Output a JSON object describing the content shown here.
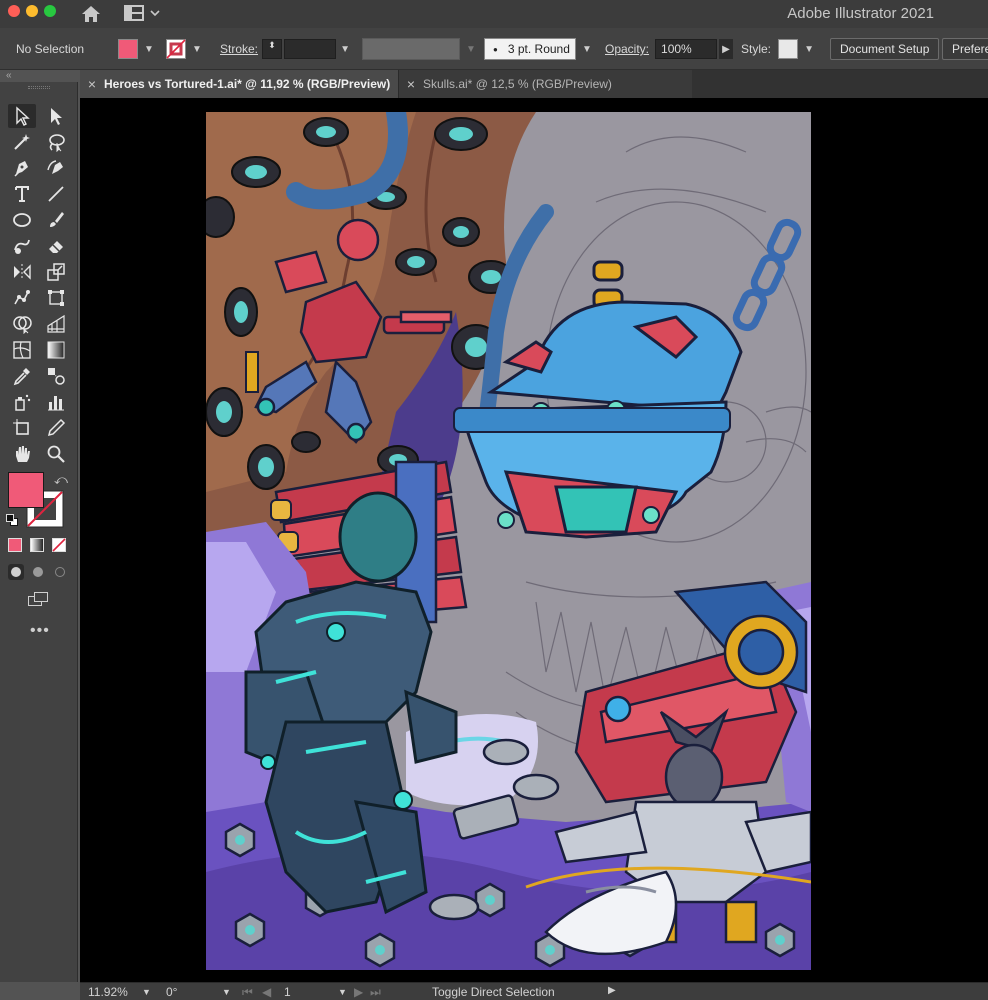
{
  "window": {
    "app_title": "Adobe Illustrator 2021"
  },
  "control_bar": {
    "selection_status": "No Selection",
    "fill_color": "#f05a78",
    "stroke_label": "Stroke:",
    "stroke_weight": "",
    "brush_value": "3 pt. Round",
    "opacity_label": "Opacity:",
    "opacity_value": "100%",
    "style_label": "Style:",
    "document_setup_label": "Document Setup",
    "preferences_label": "Prefere"
  },
  "tabs": [
    {
      "label": "Heroes vs Tortured-1.ai* @ 11,92 % (RGB/Preview)",
      "active": true
    },
    {
      "label": "Skulls.ai* @ 12,5 % (RGB/Preview)",
      "active": false
    }
  ],
  "toolbar": {
    "fill_color": "#f05a78",
    "tools": [
      "selection-tool-icon",
      "direct-selection-tool-icon",
      "magic-wand-tool-icon",
      "lasso-tool-icon",
      "pen-tool-icon",
      "curvature-tool-icon",
      "type-tool-icon",
      "line-segment-tool-icon",
      "ellipse-tool-icon",
      "paintbrush-tool-icon",
      "shaper-tool-icon",
      "eraser-tool-icon",
      "reflect-tool-icon",
      "scale-tool-icon",
      "puppet-warp-tool-icon",
      "free-transform-tool-icon",
      "shape-builder-tool-icon",
      "perspective-grid-tool-icon",
      "mesh-tool-icon",
      "gradient-tool-icon",
      "eyedropper-tool-icon",
      "blend-tool-icon",
      "symbol-sprayer-tool-icon",
      "column-graph-tool-icon",
      "artboard-tool-icon",
      "slice-tool-icon",
      "hand-tool-icon",
      "zoom-tool-icon"
    ]
  },
  "status_bar": {
    "zoom_value": "11.92%",
    "rotation_value": "0°",
    "artboard_number": "1",
    "current_tool_hint": "Toggle Direct Selection"
  }
}
